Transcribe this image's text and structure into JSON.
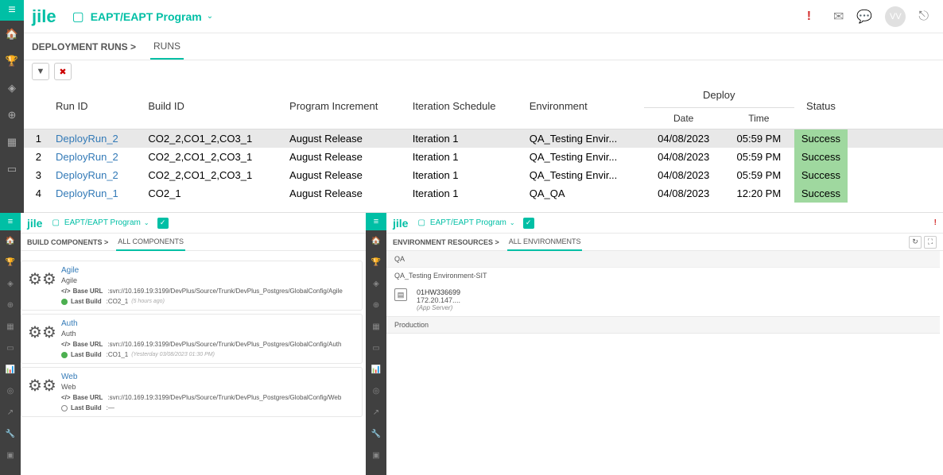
{
  "logo_text": "jile",
  "program": "EAPT/EAPT Program",
  "top": {
    "breadcrumb": "DEPLOYMENT RUNS >",
    "tab_runs": "RUNS",
    "cols": {
      "run_id": "Run ID",
      "build_id": "Build ID",
      "prog_inc": "Program Increment",
      "iter": "Iteration Schedule",
      "env": "Environment",
      "deploy": "Deploy",
      "date": "Date",
      "time": "Time",
      "status": "Status"
    },
    "rows": [
      {
        "n": "1",
        "run": "DeployRun_2",
        "build": "CO2_2,CO1_2,CO3_1",
        "pi": "August Release",
        "it": "Iteration 1",
        "env": "QA_Testing Envir...",
        "date": "04/08/2023",
        "time": "05:59 PM",
        "status": "Success"
      },
      {
        "n": "2",
        "run": "DeployRun_2",
        "build": "CO2_2,CO1_2,CO3_1",
        "pi": "August Release",
        "it": "Iteration 1",
        "env": "QA_Testing Envir...",
        "date": "04/08/2023",
        "time": "05:59 PM",
        "status": "Success"
      },
      {
        "n": "3",
        "run": "DeployRun_2",
        "build": "CO2_2,CO1_2,CO3_1",
        "pi": "August Release",
        "it": "Iteration 1",
        "env": "QA_Testing Envir...",
        "date": "04/08/2023",
        "time": "05:59 PM",
        "status": "Success"
      },
      {
        "n": "4",
        "run": "DeployRun_1",
        "build": "CO2_1",
        "pi": "August Release",
        "it": "Iteration 1",
        "env": "QA_QA",
        "date": "04/08/2023",
        "time": "12:20 PM",
        "status": "Success"
      }
    ]
  },
  "bl": {
    "breadcrumb": "BUILD COMPONENTS >",
    "tab": "ALL COMPONENTS",
    "base_url_lbl": "Base URL",
    "last_build_lbl": "Last Build",
    "components": [
      {
        "name": "Agile",
        "sub": "Agile",
        "url": "svn://10.169.19:3199/DevPlus/Source/Trunk/DevPlus_Postgres/GlobalConfig/Agile",
        "last": "CO2_1",
        "meta": "(5 hours ago)",
        "status": "ok"
      },
      {
        "name": "Auth",
        "sub": "Auth",
        "url": "svn://10.169.19:3199/DevPlus/Source/Trunk/DevPlus_Postgres/GlobalConfig/Auth",
        "last": "CO1_1",
        "meta": "(Yesterday 03/08/2023 01:30 PM)",
        "status": "ok"
      },
      {
        "name": "Web",
        "sub": "Web",
        "url": "svn://10.169.19:3199/DevPlus/Source/Trunk/DevPlus_Postgres/GlobalConfig/Web",
        "last": "—",
        "meta": "",
        "status": "run"
      }
    ]
  },
  "br": {
    "breadcrumb": "ENVIRONMENT RESOURCES >",
    "tab": "ALL ENVIRONMENTS",
    "qa_head": "QA",
    "qa_env": "QA_Testing Environment-SIT",
    "resource": {
      "id": "01HW336699",
      "ip": "172.20.147....",
      "type": "(App Server)"
    },
    "prod_head": "Production"
  },
  "avatar_initials": "VV"
}
